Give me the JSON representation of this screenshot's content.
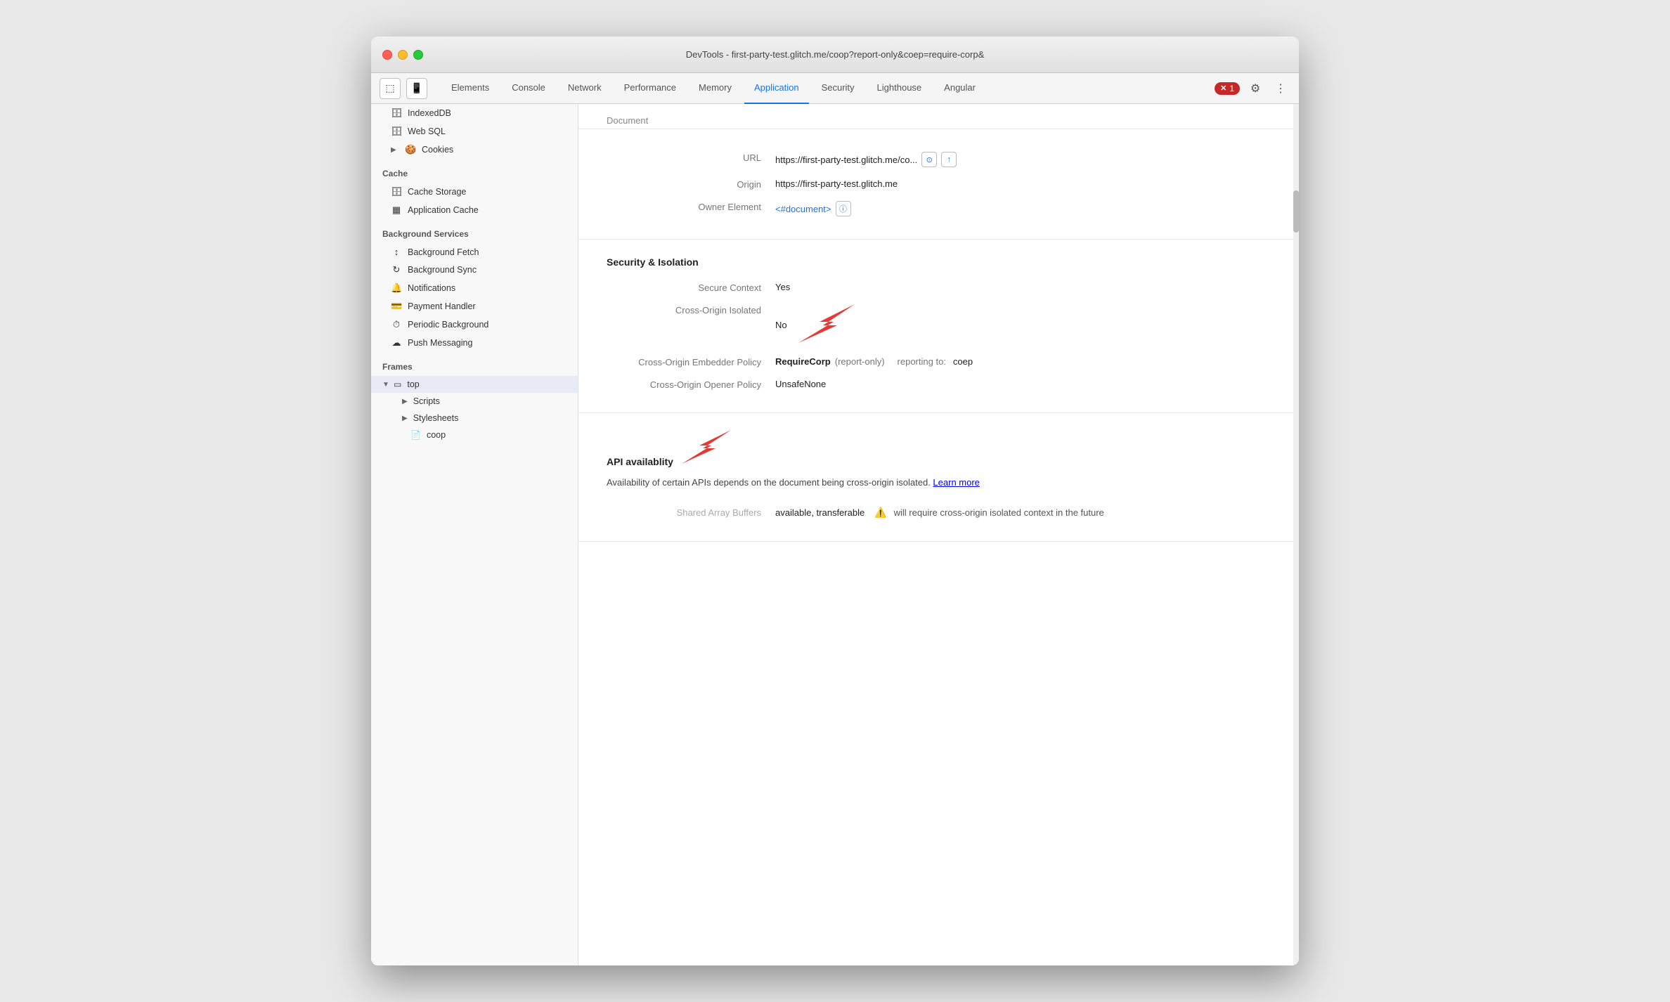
{
  "window": {
    "title": "DevTools - first-party-test.glitch.me/coop?report-only&coep=require-corp&"
  },
  "toolbar": {
    "cursor_icon": "⬦",
    "mobile_icon": "▭",
    "tabs": [
      {
        "id": "elements",
        "label": "Elements",
        "active": false
      },
      {
        "id": "console",
        "label": "Console",
        "active": false
      },
      {
        "id": "network",
        "label": "Network",
        "active": false
      },
      {
        "id": "performance",
        "label": "Performance",
        "active": false
      },
      {
        "id": "memory",
        "label": "Memory",
        "active": false
      },
      {
        "id": "application",
        "label": "Application",
        "active": true
      },
      {
        "id": "security",
        "label": "Security",
        "active": false
      },
      {
        "id": "lighthouse",
        "label": "Lighthouse",
        "active": false
      },
      {
        "id": "angular",
        "label": "Angular",
        "active": false
      }
    ],
    "error_count": "1",
    "gear_icon": "⚙",
    "dots_icon": "⋮"
  },
  "sidebar": {
    "sections": [
      {
        "id": "storage",
        "items": [
          {
            "label": "IndexedDB",
            "icon": "🗄",
            "indent": 1
          },
          {
            "label": "Web SQL",
            "icon": "🗄",
            "indent": 1
          },
          {
            "label": "Cookies",
            "icon": "🍪",
            "indent": 1,
            "has_arrow": true
          }
        ]
      },
      {
        "id": "cache",
        "header": "Cache",
        "items": [
          {
            "label": "Cache Storage",
            "icon": "🗄",
            "indent": 1
          },
          {
            "label": "Application Cache",
            "icon": "▦",
            "indent": 1
          }
        ]
      },
      {
        "id": "background_services",
        "header": "Background Services",
        "items": [
          {
            "label": "Background Fetch",
            "icon": "↕",
            "indent": 1
          },
          {
            "label": "Background Sync",
            "icon": "↻",
            "indent": 1
          },
          {
            "label": "Notifications",
            "icon": "🔔",
            "indent": 1
          },
          {
            "label": "Payment Handler",
            "icon": "💳",
            "indent": 1
          },
          {
            "label": "Periodic Background",
            "icon": "⏱",
            "indent": 1
          },
          {
            "label": "Push Messaging",
            "icon": "☁",
            "indent": 1
          }
        ]
      },
      {
        "id": "frames",
        "header": "Frames",
        "items": []
      }
    ],
    "frames_tree": {
      "top": {
        "label": "top",
        "icon": "▭",
        "expanded": true,
        "children": [
          {
            "label": "Scripts",
            "has_arrow": true
          },
          {
            "label": "Stylesheets",
            "has_arrow": true
          },
          {
            "label": "coop",
            "icon": "📄"
          }
        ]
      }
    }
  },
  "content": {
    "document_label": "Document",
    "sections": [
      {
        "id": "url-origin",
        "properties": [
          {
            "label": "URL",
            "value": "https://first-party-test.glitch.me/co...",
            "has_copy_icon": true,
            "has_link_icon": true,
            "type": "url"
          },
          {
            "label": "Origin",
            "value": "https://first-party-test.glitch.me",
            "type": "text"
          },
          {
            "label": "Owner Element",
            "value": "<#document>",
            "has_info_icon": true,
            "type": "link"
          }
        ]
      },
      {
        "id": "security-isolation",
        "title": "Security & Isolation",
        "properties": [
          {
            "label": "Secure Context",
            "value": "Yes",
            "type": "text"
          },
          {
            "label": "Cross-Origin Isolated",
            "value": "No",
            "type": "text",
            "has_red_arrow": true
          },
          {
            "label": "Cross-Origin Embedder Policy",
            "main_value": "RequireCorp",
            "sub_value": "(report-only)",
            "reporting_label": "reporting to:",
            "reporting_value": "coep",
            "type": "coep"
          },
          {
            "label": "Cross-Origin Opener Policy",
            "value": "UnsafeNone",
            "type": "text"
          }
        ]
      },
      {
        "id": "api-availability",
        "title": "API availablity",
        "has_red_arrow": true,
        "description": "Availability of certain APIs depends on the document being cross-origin isolated.",
        "learn_more_text": "Learn more",
        "learn_more_url": "#",
        "properties": [
          {
            "label": "Shared Array Buffers",
            "value": "available, transferable",
            "warning": "⚠",
            "warning_note": "will require cross-origin isolated context in the future",
            "type": "warning-row"
          }
        ]
      }
    ]
  }
}
